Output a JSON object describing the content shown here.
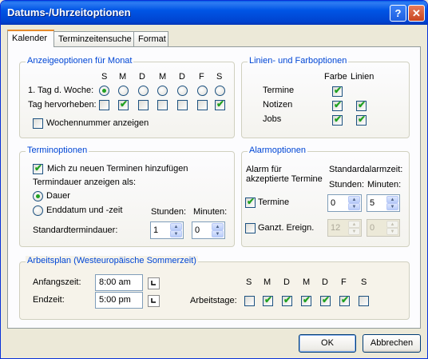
{
  "window": {
    "title": "Datums-/Uhrzeitoptionen",
    "help_glyph": "?",
    "close_glyph": "✕"
  },
  "tabs": [
    {
      "label": "Kalender"
    },
    {
      "label": "Terminzeitensuche"
    },
    {
      "label": "Format"
    }
  ],
  "month": {
    "legend": "Anzeigeoptionen für Monat",
    "days": [
      "S",
      "M",
      "D",
      "M",
      "D",
      "F",
      "S"
    ],
    "first_day_label": "1. Tag d. Woche:",
    "highlight_label": "Tag hervorheben:",
    "week_numbers_label": "Wochennummer anzeigen"
  },
  "colors": {
    "legend": "Linien- und Farboptionen",
    "col_color": "Farbe",
    "col_lines": "Linien",
    "rows": [
      {
        "label": "Termine"
      },
      {
        "label": "Notizen"
      },
      {
        "label": "Jobs"
      }
    ]
  },
  "appointments": {
    "legend": "Terminoptionen",
    "add_label": "Mich zu neuen Terminen hinzufügen",
    "duration_label": "Termindauer anzeigen als:",
    "opt_duration": "Dauer",
    "opt_end": "Enddatum und -zeit",
    "std_duration_label": "Standardtermindauer:",
    "hours_label": "Stunden:",
    "minutes_label": "Minuten:",
    "hours_value": "1",
    "minutes_value": "0"
  },
  "alarm": {
    "legend": "Alarmoptionen",
    "accepted_label": "Alarm für akzeptierte Termine",
    "default_label": "Standardalarmzeit:",
    "hours_label": "Stunden:",
    "minutes_label": "Minuten:",
    "row1_label": "Termine",
    "row1_hours": "0",
    "row1_minutes": "5",
    "row2_label": "Ganzt. Ereign.",
    "row2_hours": "12",
    "row2_minutes": "0"
  },
  "work": {
    "legend": "Arbeitsplan (Westeuropäische Sommerzeit)",
    "start_label": "Anfangszeit:",
    "start_value": "8:00 am",
    "end_label": "Endzeit:",
    "end_value": "5:00 pm",
    "days_label": "Arbeitstage:",
    "days": [
      "S",
      "M",
      "D",
      "M",
      "D",
      "F",
      "S"
    ]
  },
  "buttons": {
    "ok": "OK",
    "cancel": "Abbrechen"
  },
  "check_glyph": "✔",
  "spin_up_glyph": "▲",
  "spin_down_glyph": "▼"
}
